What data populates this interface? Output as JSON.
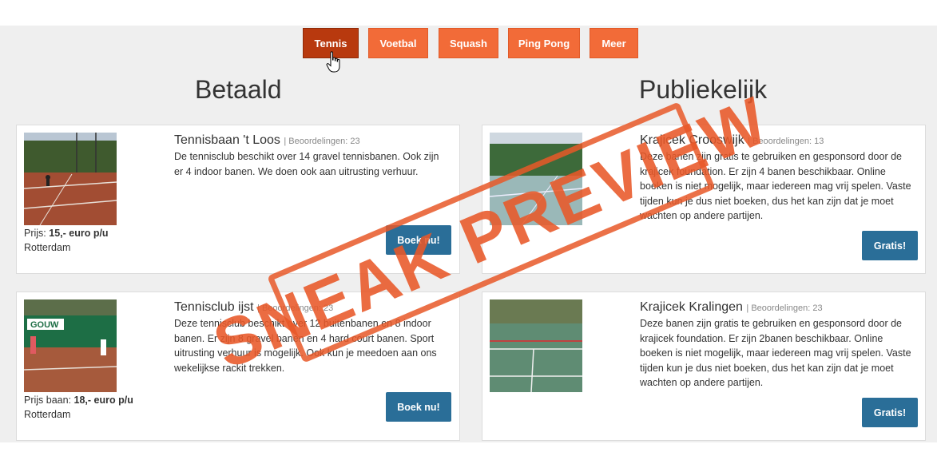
{
  "tabs": [
    "Tennis",
    "Voetbal",
    "Squash",
    "Ping Pong",
    "Meer"
  ],
  "active_tab": "Tennis",
  "columns": {
    "paid_title": "Betaald",
    "public_title": "Publiekelijk"
  },
  "paid": [
    {
      "name": "Tennisbaan 't Loos",
      "rating": "| Beoordelingen: 23",
      "description": "De tennisclub beschikt over 14 gravel tennisbanen. Ook zijn er 4 indoor banen. We doen ook aan uitrusting verhuur.",
      "price_label": "Prijs: ",
      "price_value": "15,- euro p/u",
      "city": "Rotterdam",
      "button": "Boek nu!"
    },
    {
      "name": "Tennisclub ijst",
      "rating": "| Beoordelingen: 23",
      "description": "Deze tennisclub beschikt over 12 buitenbanen en 8 indoor banen. Er zijn 8 gravel banen en 4 hard court banen. Sport uitrusting verhuur is mogelijk. Ook kun je meedoen aan ons wekelijkse rackit trekken.",
      "price_label": "Prijs baan: ",
      "price_value": "18,- euro p/u",
      "city": "Rotterdam",
      "button": "Boek nu!"
    }
  ],
  "public": [
    {
      "name": "Krajicek Crooswijk",
      "rating": "| Beoordelingen: 13",
      "description": "Deze banen zijn gratis te gebruiken en gesponsord door de krajicek foundation. Er zijn 4 banen beschikbaar. Online boeken is niet mogelijk, maar iedereen mag vrij spelen. Vaste tijden kun je dus niet boeken, dus het kan zijn dat je moet wachten op andere partijen.",
      "button": "Gratis!"
    },
    {
      "name": "Krajicek Kralingen",
      "rating": "| Beoordelingen: 23",
      "description": "Deze banen zijn gratis te gebruiken en gesponsord door de krajicek foundation. Er zijn 2banen beschikbaar. Online boeken is niet mogelijk, maar iedereen mag vrij spelen. Vaste tijden kun je dus niet boeken, dus het kan zijn dat je moet wachten op andere partijen.",
      "button": "Gratis!"
    }
  ],
  "overlay_stamp": "SNEAK PREVIEW",
  "colors": {
    "tab": "#f26b38",
    "tab_active": "#b8390e",
    "button": "#2a6e98",
    "stamp": "#e85828",
    "background": "#efefef"
  }
}
